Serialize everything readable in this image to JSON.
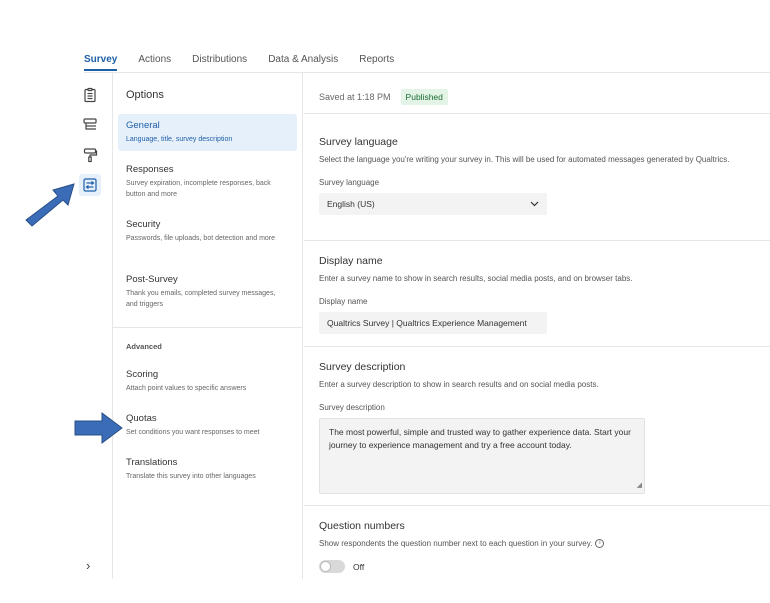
{
  "tabs": [
    {
      "label": "Survey",
      "active": true
    },
    {
      "label": "Actions"
    },
    {
      "label": "Distributions"
    },
    {
      "label": "Data & Analysis"
    },
    {
      "label": "Reports"
    }
  ],
  "rail": {
    "icons": [
      "survey-icon",
      "flow-icon",
      "look-feel-icon",
      "options-icon"
    ],
    "active": "options-icon",
    "expand": "›"
  },
  "options": {
    "title": "Options",
    "items": [
      {
        "title": "General",
        "desc": "Language, title, survey description",
        "active": true
      },
      {
        "title": "Responses",
        "desc": "Survey expiration, incomplete responses, back button and more"
      },
      {
        "title": "Security",
        "desc": "Passwords, file uploads, bot detection and more"
      },
      {
        "title": "Post-Survey",
        "desc": "Thank you emails, completed survey messages, and triggers"
      }
    ],
    "advanced_label": "Advanced",
    "advanced": [
      {
        "title": "Scoring",
        "desc": "Attach point values to specific answers"
      },
      {
        "title": "Quotas",
        "desc": "Set conditions you want responses to meet"
      },
      {
        "title": "Translations",
        "desc": "Translate this survey into other languages"
      }
    ]
  },
  "status": {
    "saved": "Saved at 1:18 PM",
    "badge": "Published"
  },
  "language": {
    "title": "Survey language",
    "desc": "Select the language you're writing your survey in. This will be used for automated messages generated by Qualtrics.",
    "label": "Survey language",
    "value": "English (US)"
  },
  "display_name": {
    "title": "Display name",
    "desc": "Enter a survey name to show in search results, social media posts, and on browser tabs.",
    "label": "Display name",
    "value": "Qualtrics Survey | Qualtrics Experience Management"
  },
  "description": {
    "title": "Survey description",
    "desc": "Enter a survey description to show in search results and on social media posts.",
    "label": "Survey description",
    "value": "The most powerful, simple and trusted way to gather experience data. Start your journey to experience management and try a free account today."
  },
  "question_numbers": {
    "title": "Question numbers",
    "desc": "Show respondents the question number next to each question in your survey.",
    "toggle_label": "Off"
  },
  "colors": {
    "accent": "#1f5fa8",
    "active_bg": "#e6f0fb",
    "badge_bg": "#e3f3e6",
    "badge_text": "#1b6b33",
    "annotation_arrow": "#3b6cb7"
  }
}
